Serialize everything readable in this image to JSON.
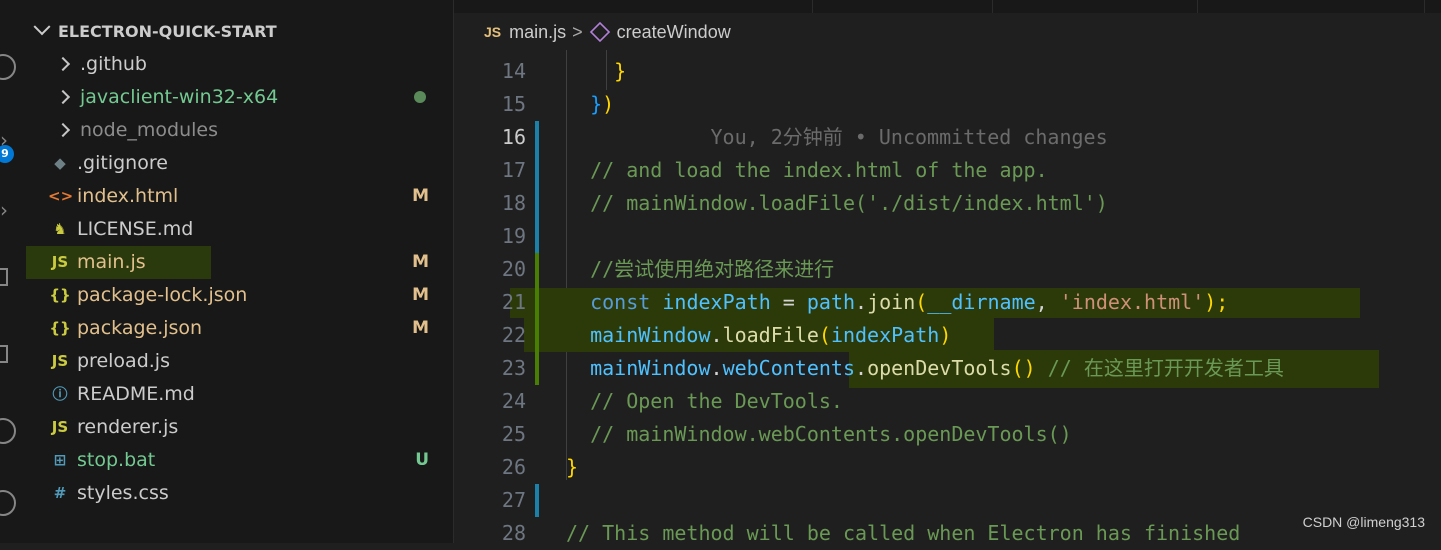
{
  "activity_bar": {
    "badge_count": "9"
  },
  "explorer": {
    "title": "ELECTRON-QUICK-START",
    "items": [
      {
        "name": ".github",
        "type": "folder",
        "color": "#cccccc"
      },
      {
        "name": "javaclient-win32-x64",
        "type": "folder",
        "color": "#73c991",
        "status": "dot"
      },
      {
        "name": "node_modules",
        "type": "folder",
        "color": "#8c8c8c"
      },
      {
        "name": ".gitignore",
        "type": "file",
        "icon": "git-icon",
        "glyph": "◆",
        "icon_color": "#6d8086",
        "color": "#cccccc"
      },
      {
        "name": "index.html",
        "type": "file",
        "icon": "html-icon",
        "glyph": "<>",
        "icon_color": "#e37933",
        "color": "#e2c08d",
        "status": "M"
      },
      {
        "name": "LICENSE.md",
        "type": "file",
        "icon": "license-icon",
        "glyph": "♞",
        "icon_color": "#cbcb41",
        "color": "#cccccc"
      },
      {
        "name": "main.js",
        "type": "file",
        "icon": "js-icon",
        "glyph": "JS",
        "icon_color": "#cbcb41",
        "color": "#e2c08d",
        "status": "M"
      },
      {
        "name": "package-lock.json",
        "type": "file",
        "icon": "json-icon",
        "glyph": "{}",
        "icon_color": "#cbcb41",
        "color": "#e2c08d",
        "status": "M"
      },
      {
        "name": "package.json",
        "type": "file",
        "icon": "json-icon",
        "glyph": "{}",
        "icon_color": "#cbcb41",
        "color": "#e2c08d",
        "status": "M"
      },
      {
        "name": "preload.js",
        "type": "file",
        "icon": "js-icon",
        "glyph": "JS",
        "icon_color": "#cbcb41",
        "color": "#cccccc"
      },
      {
        "name": "README.md",
        "type": "file",
        "icon": "info-icon",
        "glyph": "ⓘ",
        "icon_color": "#519aba",
        "color": "#cccccc"
      },
      {
        "name": "renderer.js",
        "type": "file",
        "icon": "js-icon",
        "glyph": "JS",
        "icon_color": "#cbcb41",
        "color": "#cccccc"
      },
      {
        "name": "stop.bat",
        "type": "file",
        "icon": "windows-icon",
        "glyph": "⊞",
        "icon_color": "#519aba",
        "color": "#73c991",
        "status": "U"
      },
      {
        "name": "styles.css",
        "type": "file",
        "icon": "css-icon",
        "glyph": "#",
        "icon_color": "#519aba",
        "color": "#cccccc"
      }
    ],
    "status_colors": {
      "M": "#e2c08d",
      "U": "#73c991"
    }
  },
  "breadcrumb": {
    "file_icon_label": "JS",
    "file": "main.js",
    "separator": ">",
    "symbol": "createWindow"
  },
  "editor": {
    "lines": [
      {
        "num": "14",
        "tokens": [
          {
            "t": "    ",
            "c": "c-plain"
          },
          {
            "t": "}",
            "c": "c-br"
          }
        ]
      },
      {
        "num": "15",
        "tokens": [
          {
            "t": "  ",
            "c": "c-plain"
          },
          {
            "t": "}",
            "c": "c-br2"
          },
          {
            "t": ")",
            "c": "c-br"
          }
        ]
      },
      {
        "num": "16",
        "active": true,
        "tokens": [
          {
            "t": "            You, 2分钟前 • Uncommitted changes",
            "c": "c-ghost"
          }
        ]
      },
      {
        "num": "17",
        "tokens": [
          {
            "t": "  // and load the index.html of the app.",
            "c": "c-cmt"
          }
        ]
      },
      {
        "num": "18",
        "tokens": [
          {
            "t": "  // mainWindow.loadFile('./dist/index.html')",
            "c": "c-cmt"
          }
        ]
      },
      {
        "num": "19",
        "tokens": []
      },
      {
        "num": "20",
        "tokens": [
          {
            "t": "  //尝试使用绝对路径来进行",
            "c": "c-cmt"
          }
        ]
      },
      {
        "num": "21",
        "tokens": [
          {
            "t": "  ",
            "c": "c-plain"
          },
          {
            "t": "const",
            "c": "c-kw"
          },
          {
            "t": " ",
            "c": "c-plain"
          },
          {
            "t": "indexPath",
            "c": "c-var"
          },
          {
            "t": " = ",
            "c": "c-plain"
          },
          {
            "t": "path",
            "c": "c-var"
          },
          {
            "t": ".",
            "c": "c-plain"
          },
          {
            "t": "join",
            "c": "c-fn"
          },
          {
            "t": "(",
            "c": "c-br"
          },
          {
            "t": "__dirname",
            "c": "c-var"
          },
          {
            "t": ", ",
            "c": "c-plain"
          },
          {
            "t": "'index.html'",
            "c": "c-str"
          },
          {
            "t": ");",
            "c": "c-br"
          }
        ]
      },
      {
        "num": "22",
        "tokens": [
          {
            "t": "  ",
            "c": "c-plain"
          },
          {
            "t": "mainWindow",
            "c": "c-var"
          },
          {
            "t": ".",
            "c": "c-plain"
          },
          {
            "t": "loadFile",
            "c": "c-fn"
          },
          {
            "t": "(",
            "c": "c-br"
          },
          {
            "t": "indexPath",
            "c": "c-var"
          },
          {
            "t": ")",
            "c": "c-br"
          }
        ]
      },
      {
        "num": "23",
        "tokens": [
          {
            "t": "  ",
            "c": "c-plain"
          },
          {
            "t": "mainWindow",
            "c": "c-var"
          },
          {
            "t": ".",
            "c": "c-plain"
          },
          {
            "t": "webContents",
            "c": "c-var"
          },
          {
            "t": ".",
            "c": "c-plain"
          },
          {
            "t": "openDevTools",
            "c": "c-fn"
          },
          {
            "t": "()",
            "c": "c-br"
          },
          {
            "t": " // 在这里打开开发者工具",
            "c": "c-cmt"
          }
        ]
      },
      {
        "num": "24",
        "tokens": [
          {
            "t": "  // Open the DevTools.",
            "c": "c-cmt"
          }
        ]
      },
      {
        "num": "25",
        "tokens": [
          {
            "t": "  // mainWindow.webContents.openDevTools()",
            "c": "c-cmt"
          }
        ]
      },
      {
        "num": "26",
        "tokens": [
          {
            "t": "}",
            "c": "c-br"
          }
        ]
      },
      {
        "num": "27",
        "tokens": []
      },
      {
        "num": "28",
        "tokens": [
          {
            "t": "// This method will be called when Electron has finished",
            "c": "c-cmt"
          }
        ]
      }
    ],
    "gutter": {
      "modified_color": "#1b81a8",
      "added_color": "#487e02"
    },
    "highlight_color": "#2c3a0a"
  },
  "watermark": "CSDN @limeng313"
}
